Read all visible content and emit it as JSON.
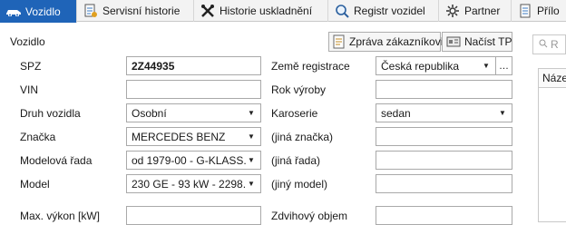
{
  "tabs": [
    {
      "label": "Vozidlo",
      "icon": "car-icon",
      "active": true
    },
    {
      "label": "Servisní historie",
      "icon": "document-icon"
    },
    {
      "label": "Historie uskladnění",
      "icon": "tools-icon"
    },
    {
      "label": "Registr vozidel",
      "icon": "search-icon"
    },
    {
      "label": "Partner",
      "icon": "gear-icon"
    },
    {
      "label": "Přílo",
      "icon": "attachment-icon"
    }
  ],
  "section": {
    "title": "Vozidlo"
  },
  "toolbar": {
    "report_label": "Zpráva zákazníkovi",
    "load_label": "Načíst TP"
  },
  "left": {
    "spz": {
      "label": "SPZ",
      "value": "2Z44935"
    },
    "vin": {
      "label": "VIN",
      "value": ""
    },
    "druh": {
      "label": "Druh vozidla",
      "value": "Osobní"
    },
    "znacka": {
      "label": "Značka",
      "value": "MERCEDES BENZ"
    },
    "rada": {
      "label": "Modelová řada",
      "value": "od 1979-00 - G-KLASS..."
    },
    "model": {
      "label": "Model",
      "value": "230 GE - 93 kW - 2298..."
    },
    "vykon": {
      "label": "Max. výkon [kW]",
      "value": ""
    }
  },
  "right": {
    "zeme": {
      "label": "Země registrace",
      "value": "Česká republika"
    },
    "rok": {
      "label": "Rok výroby",
      "value": ""
    },
    "karoserie": {
      "label": "Karoserie",
      "value": "sedan"
    },
    "jina_znacka": {
      "label": "(jiná značka)",
      "value": ""
    },
    "jina_rada": {
      "label": "(jiná řada)",
      "value": ""
    },
    "jiny_model": {
      "label": "(jiný model)",
      "value": ""
    },
    "zdvih": {
      "label": "Zdvihový objem",
      "value": ""
    }
  },
  "side_panel": {
    "search_placeholder": "R",
    "column_header": "Náze"
  },
  "colors": {
    "tab_active": "#1f64b8",
    "border": "#a9a9a9"
  }
}
